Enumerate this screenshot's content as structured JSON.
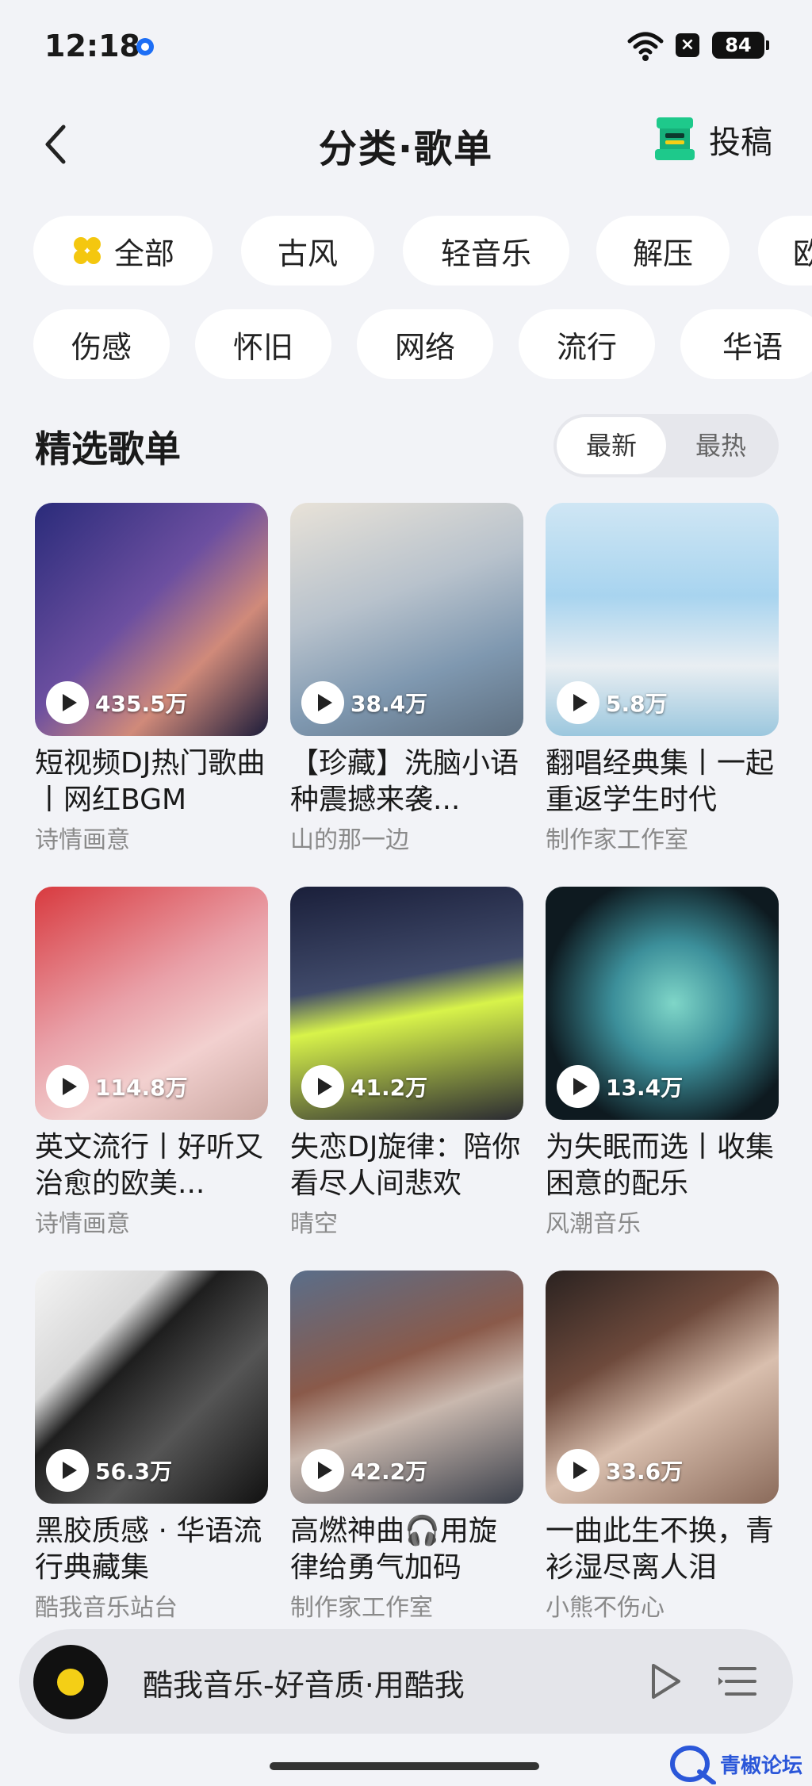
{
  "status_bar": {
    "time": "12:18",
    "battery": "84"
  },
  "nav": {
    "title": "分类·歌单",
    "submit_label": "投稿"
  },
  "categories_row1": [
    "全部",
    "古风",
    "轻音乐",
    "解压",
    "欧"
  ],
  "categories_row2": [
    "伤感",
    "怀旧",
    "网络",
    "流行",
    "华语"
  ],
  "section": {
    "title": "精选歌单",
    "sort_options": [
      "最新",
      "最热"
    ]
  },
  "playlists": [
    {
      "title": "短视频DJ热门歌曲丨网红BGM",
      "author": "诗情画意",
      "plays": "435.5万"
    },
    {
      "title": "【珍藏】洗脑小语种震撼来袭...",
      "author": "山的那一边",
      "plays": "38.4万"
    },
    {
      "title": "翻唱经典集丨一起重返学生时代",
      "author": "制作家工作室",
      "plays": "5.8万"
    },
    {
      "title": "英文流行丨好听又治愈的欧美...",
      "author": "诗情画意",
      "plays": "114.8万"
    },
    {
      "title": "失恋DJ旋律：陪你看尽人间悲欢",
      "author": "晴空",
      "plays": "41.2万"
    },
    {
      "title": "为失眠而选丨收集困意的配乐",
      "author": "风潮音乐",
      "plays": "13.4万"
    },
    {
      "title": "黑胶质感 · 华语流行典藏集",
      "author": "酷我音乐站台",
      "plays": "56.3万"
    },
    {
      "title": "高燃神曲🎧用旋律给勇气加码",
      "author": "制作家工作室",
      "plays": "42.2万"
    },
    {
      "title": "一曲此生不换，青衫湿尽离人泪",
      "author": "小熊不伤心",
      "plays": "33.6万"
    }
  ],
  "player": {
    "text": "酷我音乐-好音质·用酷我"
  },
  "watermark": {
    "text": "青椒论坛"
  },
  "colors": {
    "accent_blue": "#1d6ef5",
    "disc_yellow": "#f4cf16",
    "submit_green": "#1ec98b"
  }
}
